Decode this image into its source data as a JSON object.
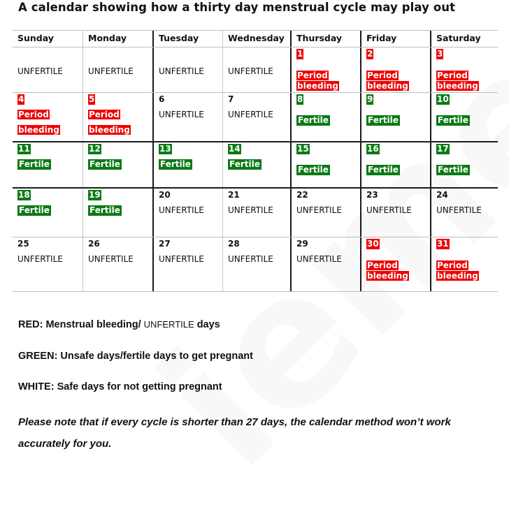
{
  "title": "A calendar showing how a thirty day menstrual cycle may play out",
  "watermark": "iemed",
  "calendar": {
    "days_of_week": [
      "Sunday",
      "Monday",
      "Tuesday",
      "Wednesday",
      "Thursday",
      "Friday",
      "Saturday"
    ],
    "weeks": [
      [
        {
          "day": "",
          "label": "UNFERTILE",
          "status": "unfertile"
        },
        {
          "day": "",
          "label": "UNFERTILE",
          "status": "unfertile"
        },
        {
          "day": "",
          "label": "UNFERTILE",
          "status": "unfertile"
        },
        {
          "day": "",
          "label": "UNFERTILE",
          "status": "unfertile"
        },
        {
          "day": "1",
          "label": "Period bleeding",
          "status": "period"
        },
        {
          "day": "2",
          "label": "Period bleeding",
          "status": "period"
        },
        {
          "day": "3",
          "label": "Period bleeding",
          "status": "period"
        }
      ],
      [
        {
          "day": "4",
          "label": "Period bleeding",
          "status": "period"
        },
        {
          "day": "5",
          "label": "Period bleeding",
          "status": "period"
        },
        {
          "day": "6",
          "label": "UNFERTILE",
          "status": "unfertile"
        },
        {
          "day": "7",
          "label": "UNFERTILE",
          "status": "unfertile"
        },
        {
          "day": "8",
          "label": "Fertile",
          "status": "fertile"
        },
        {
          "day": "9",
          "label": "Fertile",
          "status": "fertile"
        },
        {
          "day": "10",
          "label": "Fertile",
          "status": "fertile"
        }
      ],
      [
        {
          "day": "11",
          "label": "Fertile",
          "status": "fertile"
        },
        {
          "day": "12",
          "label": "Fertile",
          "status": "fertile"
        },
        {
          "day": "13",
          "label": "Fertile",
          "status": "fertile"
        },
        {
          "day": "14",
          "label": "Fertile",
          "status": "fertile"
        },
        {
          "day": "15",
          "label": "Fertile",
          "status": "fertile"
        },
        {
          "day": "16",
          "label": "Fertile",
          "status": "fertile"
        },
        {
          "day": "17",
          "label": "Fertile",
          "status": "fertile"
        }
      ],
      [
        {
          "day": "18",
          "label": "Fertile",
          "status": "fertile"
        },
        {
          "day": "19",
          "label": "Fertile",
          "status": "fertile"
        },
        {
          "day": "20",
          "label": "UNFERTILE",
          "status": "unfertile"
        },
        {
          "day": "21",
          "label": "UNFERTILE",
          "status": "unfertile"
        },
        {
          "day": "22",
          "label": "UNFERTILE",
          "status": "unfertile"
        },
        {
          "day": "23",
          "label": "UNFERTILE",
          "status": "unfertile"
        },
        {
          "day": "24",
          "label": "UNFERTILE",
          "status": "unfertile"
        }
      ],
      [
        {
          "day": "25",
          "label": "UNFERTILE",
          "status": "unfertile"
        },
        {
          "day": "26",
          "label": "UNFERTILE",
          "status": "unfertile"
        },
        {
          "day": "27",
          "label": "UNFERTILE",
          "status": "unfertile"
        },
        {
          "day": "28",
          "label": "UNFERTILE",
          "status": "unfertile"
        },
        {
          "day": "29",
          "label": "UNFERTILE",
          "status": "unfertile"
        },
        {
          "day": "30",
          "label": "Period bleeding",
          "status": "period"
        },
        {
          "day": "31",
          "label": "Period bleeding",
          "status": "period"
        }
      ]
    ]
  },
  "legend": {
    "red": {
      "prefix": "RED: Menstrual bleeding/ ",
      "middle": "UNFERTILE",
      "suffix": " days"
    },
    "green": "GREEN: Unsafe days/fertile days to get pregnant",
    "white": "WHITE: Safe days for not getting pregnant"
  },
  "note": "Please note that if every cycle is shorter than 27 days, the calendar method won’t work accurately for you.",
  "colors": {
    "period": "#ee0000",
    "fertile": "#0c7a16",
    "unfertile": "#ffffff"
  }
}
